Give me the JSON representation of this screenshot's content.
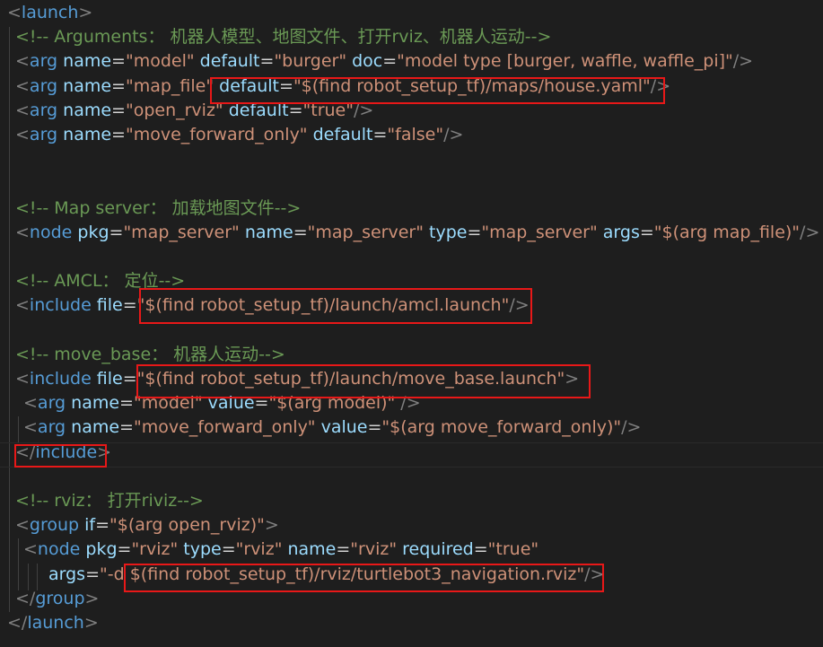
{
  "editor": {
    "lines": [
      {
        "indent": 0,
        "tokens": [
          [
            "bracket",
            "<"
          ],
          [
            "tag",
            "launch"
          ],
          [
            "bracket",
            ">"
          ]
        ]
      },
      {
        "indent": 1,
        "tokens": [
          [
            "comment",
            "<!-- Arguments： 机器人模型、地图文件、打开rviz、机器人运动-->"
          ]
        ]
      },
      {
        "indent": 1,
        "tokens": [
          [
            "bracket",
            "<"
          ],
          [
            "tag",
            "arg"
          ],
          [
            "attr",
            " name"
          ],
          [
            "eq",
            "="
          ],
          [
            "str",
            "\"model\""
          ],
          [
            "attr",
            " default"
          ],
          [
            "eq",
            "="
          ],
          [
            "str",
            "\"burger\""
          ],
          [
            "attr",
            " doc"
          ],
          [
            "eq",
            "="
          ],
          [
            "str",
            "\"model type [burger, waffle, waffle_pi]\""
          ],
          [
            "bracket",
            "/>"
          ]
        ]
      },
      {
        "indent": 1,
        "tokens": [
          [
            "bracket",
            "<"
          ],
          [
            "tag",
            "arg"
          ],
          [
            "attr",
            " name"
          ],
          [
            "eq",
            "="
          ],
          [
            "str",
            "\"map_file\""
          ],
          [
            "attr",
            " default"
          ],
          [
            "eq",
            "="
          ],
          [
            "str",
            "\"$(find robot_setup_tf)/maps/house.yaml\""
          ],
          [
            "bracket",
            "/>"
          ]
        ]
      },
      {
        "indent": 1,
        "tokens": [
          [
            "bracket",
            "<"
          ],
          [
            "tag",
            "arg"
          ],
          [
            "attr",
            " name"
          ],
          [
            "eq",
            "="
          ],
          [
            "str",
            "\"open_rviz\""
          ],
          [
            "attr",
            " default"
          ],
          [
            "eq",
            "="
          ],
          [
            "str",
            "\"true\""
          ],
          [
            "bracket",
            "/>"
          ]
        ]
      },
      {
        "indent": 1,
        "tokens": [
          [
            "bracket",
            "<"
          ],
          [
            "tag",
            "arg"
          ],
          [
            "attr",
            " name"
          ],
          [
            "eq",
            "="
          ],
          [
            "str",
            "\"move_forward_only\""
          ],
          [
            "attr",
            " default"
          ],
          [
            "eq",
            "="
          ],
          [
            "str",
            "\"false\""
          ],
          [
            "bracket",
            "/>"
          ]
        ]
      },
      {
        "indent": 1,
        "tokens": []
      },
      {
        "indent": 1,
        "tokens": []
      },
      {
        "indent": 1,
        "tokens": [
          [
            "comment",
            "<!-- Map server： 加载地图文件-->"
          ]
        ]
      },
      {
        "indent": 1,
        "tokens": [
          [
            "bracket",
            "<"
          ],
          [
            "tag",
            "node"
          ],
          [
            "attr",
            " pkg"
          ],
          [
            "eq",
            "="
          ],
          [
            "str",
            "\"map_server\""
          ],
          [
            "attr",
            " name"
          ],
          [
            "eq",
            "="
          ],
          [
            "str",
            "\"map_server\""
          ],
          [
            "attr",
            " type"
          ],
          [
            "eq",
            "="
          ],
          [
            "str",
            "\"map_server\""
          ],
          [
            "attr",
            " args"
          ],
          [
            "eq",
            "="
          ],
          [
            "str",
            "\"$(arg map_file)\""
          ],
          [
            "bracket",
            "/>"
          ]
        ]
      },
      {
        "indent": 1,
        "tokens": []
      },
      {
        "indent": 1,
        "tokens": [
          [
            "comment",
            "<!-- AMCL： 定位-->"
          ]
        ]
      },
      {
        "indent": 1,
        "tokens": [
          [
            "bracket",
            "<"
          ],
          [
            "tag",
            "include"
          ],
          [
            "attr",
            " file"
          ],
          [
            "eq",
            "="
          ],
          [
            "str",
            "\"$(find robot_setup_tf)/launch/amcl.launch\""
          ],
          [
            "bracket",
            "/>"
          ]
        ]
      },
      {
        "indent": 1,
        "tokens": []
      },
      {
        "indent": 1,
        "tokens": [
          [
            "comment",
            "<!-- move_base： 机器人运动-->"
          ]
        ]
      },
      {
        "indent": 1,
        "tokens": [
          [
            "bracket",
            "<"
          ],
          [
            "tag",
            "include"
          ],
          [
            "attr",
            " file"
          ],
          [
            "eq",
            "="
          ],
          [
            "str",
            "\"$(find robot_setup_tf)/launch/move_base.launch\""
          ],
          [
            "bracket",
            ">"
          ]
        ]
      },
      {
        "indent": 2,
        "tokens": [
          [
            "bracket",
            "<"
          ],
          [
            "tag",
            "arg"
          ],
          [
            "attr",
            " name"
          ],
          [
            "eq",
            "="
          ],
          [
            "str",
            "\"model\""
          ],
          [
            "attr",
            " value"
          ],
          [
            "eq",
            "="
          ],
          [
            "str",
            "\"$(arg model)\""
          ],
          [
            "bracket",
            " />"
          ]
        ]
      },
      {
        "indent": 2,
        "tokens": [
          [
            "bracket",
            "<"
          ],
          [
            "tag",
            "arg"
          ],
          [
            "attr",
            " name"
          ],
          [
            "eq",
            "="
          ],
          [
            "str",
            "\"move_forward_only\""
          ],
          [
            "attr",
            " value"
          ],
          [
            "eq",
            "="
          ],
          [
            "str",
            "\"$(arg move_forward_only)\""
          ],
          [
            "bracket",
            "/>"
          ]
        ]
      },
      {
        "indent": 1,
        "tokens": [
          [
            "bracket",
            "</"
          ],
          [
            "tag",
            "include"
          ],
          [
            "bracket",
            ">"
          ]
        ]
      },
      {
        "indent": 1,
        "tokens": []
      },
      {
        "indent": 1,
        "tokens": [
          [
            "comment",
            "<!-- rviz： 打开riviz-->"
          ]
        ]
      },
      {
        "indent": 1,
        "tokens": [
          [
            "bracket",
            "<"
          ],
          [
            "tag",
            "group"
          ],
          [
            "attr",
            " if"
          ],
          [
            "eq",
            "="
          ],
          [
            "str",
            "\"$(arg open_rviz)\""
          ],
          [
            "bracket",
            ">"
          ]
        ]
      },
      {
        "indent": 2,
        "tokens": [
          [
            "bracket",
            "<"
          ],
          [
            "tag",
            "node"
          ],
          [
            "attr",
            " pkg"
          ],
          [
            "eq",
            "="
          ],
          [
            "str",
            "\"rviz\""
          ],
          [
            "attr",
            " type"
          ],
          [
            "eq",
            "="
          ],
          [
            "str",
            "\"rviz\""
          ],
          [
            "attr",
            " name"
          ],
          [
            "eq",
            "="
          ],
          [
            "str",
            "\"rviz\""
          ],
          [
            "attr",
            " required"
          ],
          [
            "eq",
            "="
          ],
          [
            "str",
            "\"true\""
          ]
        ]
      },
      {
        "indent": 4,
        "tokens": [
          [
            "attr",
            "args"
          ],
          [
            "eq",
            "="
          ],
          [
            "str",
            "\"-d $(find robot_setup_tf)/rviz/turtlebot3_navigation.rviz\""
          ],
          [
            "bracket",
            "/>"
          ]
        ]
      },
      {
        "indent": 1,
        "tokens": [
          [
            "bracket",
            "</"
          ],
          [
            "tag",
            "group"
          ],
          [
            "bracket",
            ">"
          ]
        ]
      },
      {
        "indent": 0,
        "tokens": [
          [
            "bracket",
            "</"
          ],
          [
            "tag",
            "launch"
          ],
          [
            "bracket",
            ">"
          ]
        ]
      }
    ]
  },
  "colors": {
    "background": "#1e1e1e",
    "tag": "#569cd6",
    "attribute": "#9cdcfe",
    "string": "#ce9178",
    "comment": "#6a9955",
    "bracket": "#808080",
    "highlight_box": "#e81818"
  }
}
